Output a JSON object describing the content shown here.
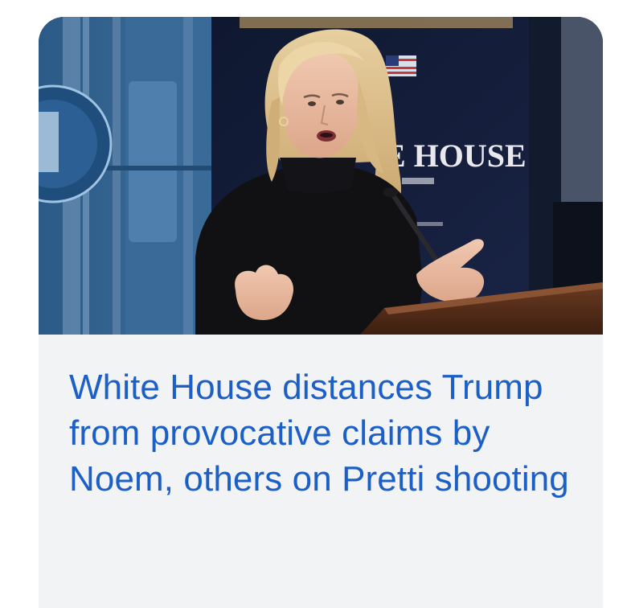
{
  "article": {
    "headline": "White House distances Trump from provocative claims by Noem, others on Pretti shooting",
    "image_alt": "Press secretary speaking at White House briefing room podium",
    "backdrop_text": "E HOUSE"
  },
  "colors": {
    "headline": "#1b5fc7",
    "card_background": "#f2f3f5",
    "page_background": "#ffffff"
  }
}
